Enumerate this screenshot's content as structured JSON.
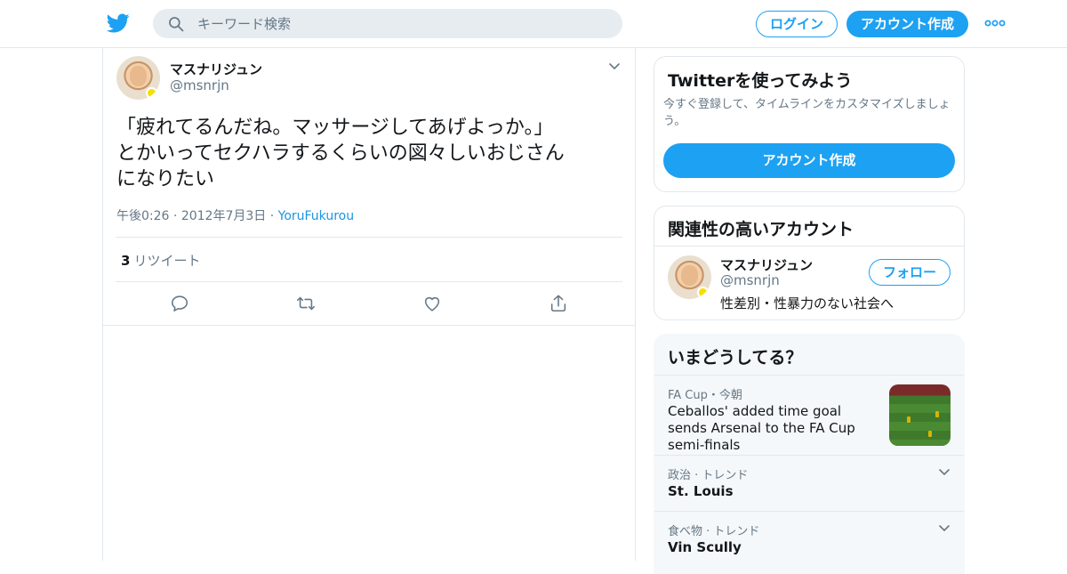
{
  "colors": {
    "accent": "#1da1f2",
    "link": "#1b95e0",
    "muted": "#657786",
    "text": "#14171a",
    "border": "#e1e8ed"
  },
  "header": {
    "logo_icon": "twitter-bird-icon",
    "search": {
      "placeholder": "キーワード検索",
      "icon": "search-icon"
    },
    "login_label": "ログイン",
    "signup_label": "アカウント作成",
    "more_icon": "more-dots-icon"
  },
  "tweet": {
    "author_name": "マスナリジュン",
    "author_handle": "@msnrjn",
    "text": "「疲れてるんだね。マッサージしてあげよっか。」\nとかいってセクハラするくらいの図々しいおじさん\nになりたい",
    "time": "午後0:26",
    "date": "2012年7月3日",
    "source": "YoruFukurou",
    "retweet_count": "3",
    "retweet_label": "リツイート",
    "actions": [
      "reply-icon",
      "retweet-icon",
      "like-icon",
      "share-icon"
    ]
  },
  "sidebar": {
    "signup_card": {
      "title": "Twitterを使ってみよう",
      "description": "今すぐ登録して、タイムラインをカスタマイズしましょう。",
      "button_label": "アカウント作成"
    },
    "related": {
      "title": "関連性の高いアカウント",
      "account": {
        "name": "マスナリジュン",
        "handle": "@msnrjn",
        "bio": "性差別・性暴力のない社会へ",
        "follow_label": "フォロー"
      }
    },
    "trends": {
      "title": "いまどうしてる？",
      "items": [
        {
          "meta": "FA Cup・今朝",
          "title": "Ceballos' added time goal sends Arsenal to the FA Cup semi-finals",
          "has_image": true
        },
        {
          "meta": "政治 · トレンド",
          "title": "St. Louis"
        },
        {
          "meta": "食べ物 · トレンド",
          "title": "Vin Scully"
        }
      ]
    }
  }
}
